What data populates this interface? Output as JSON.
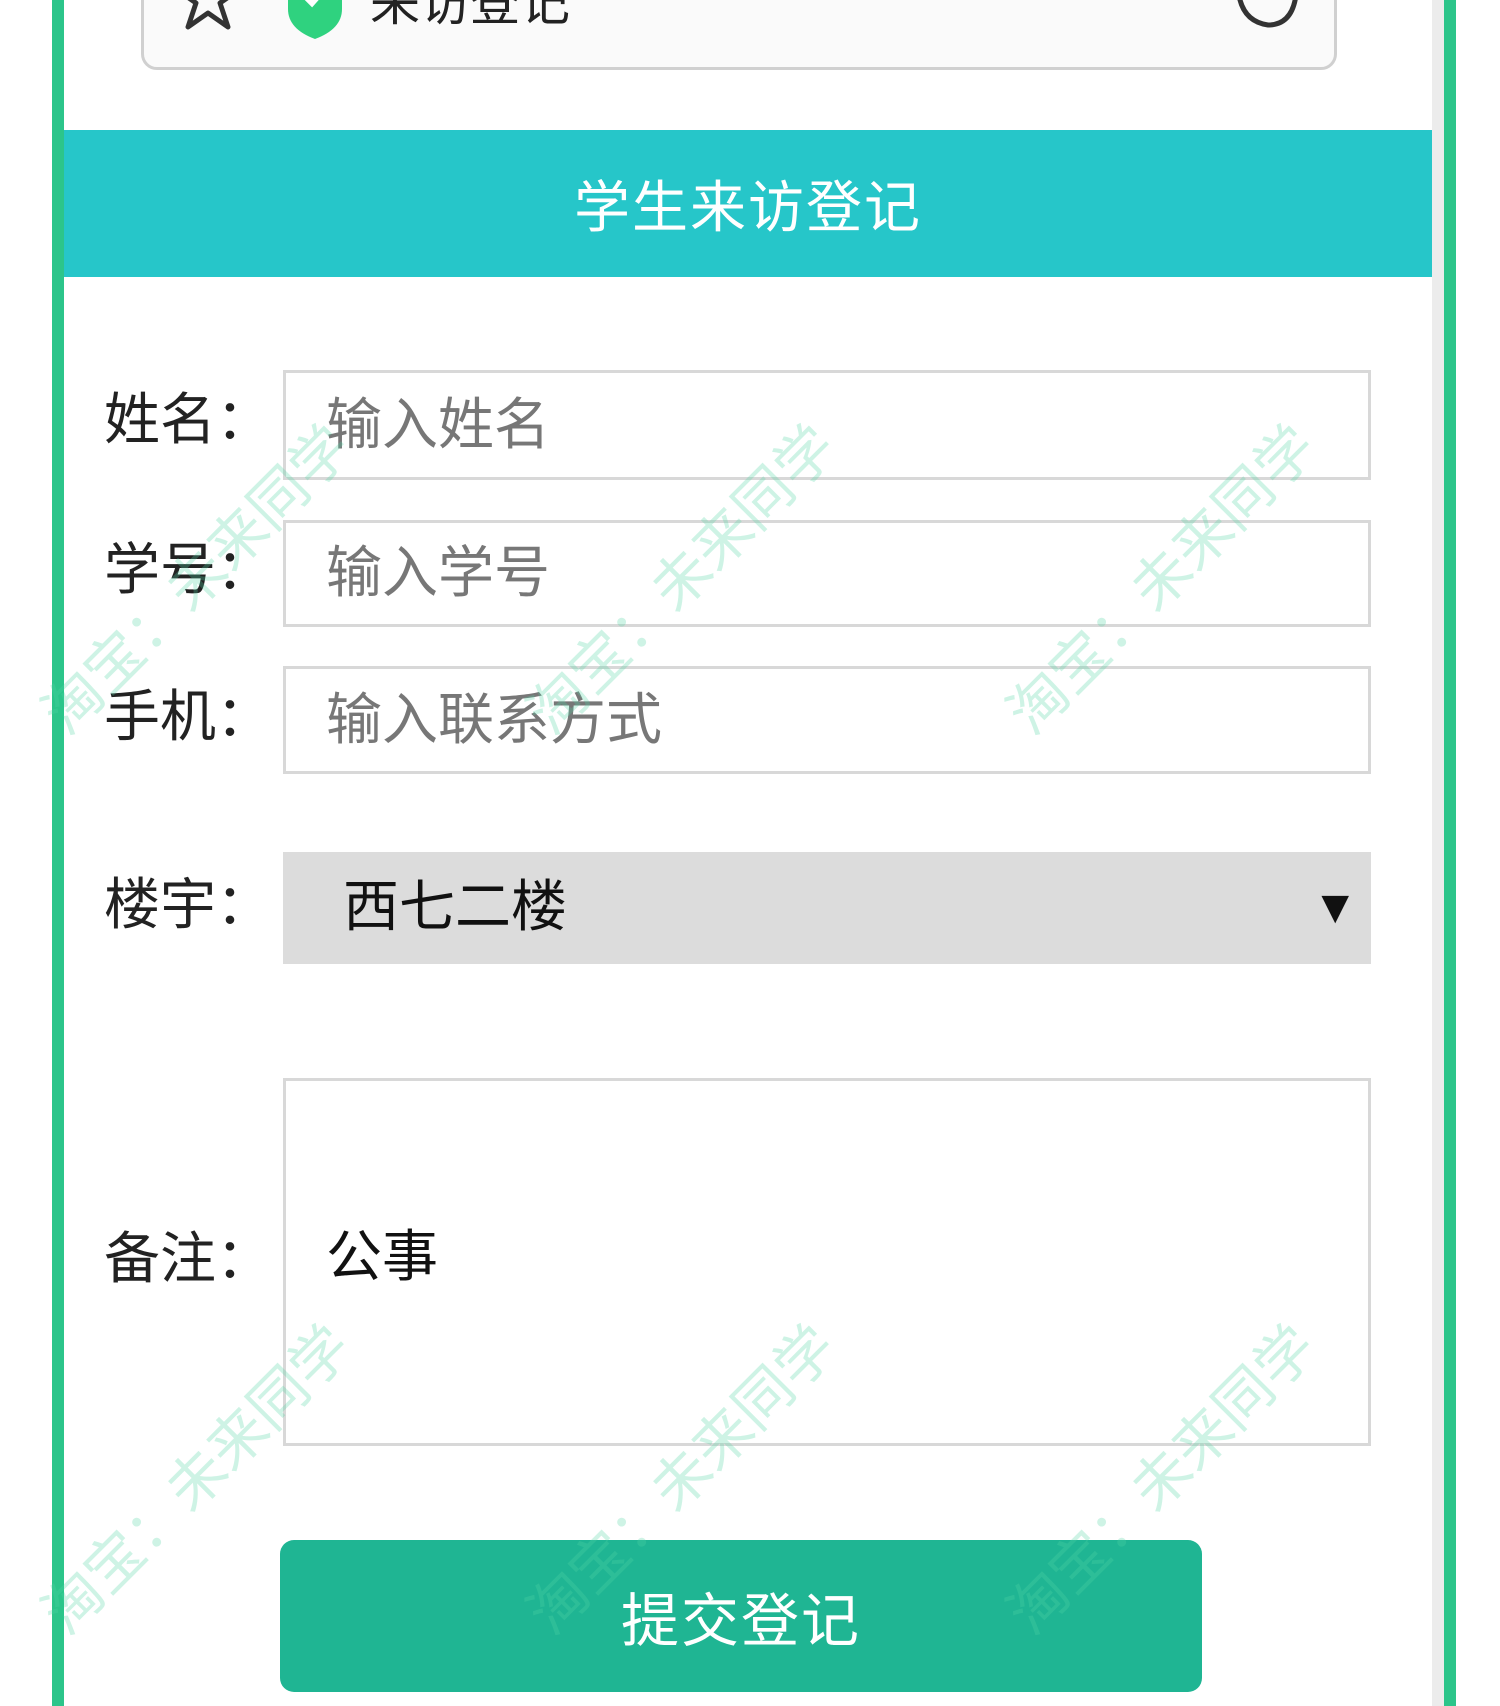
{
  "browser": {
    "page_title": "来访登记"
  },
  "header": {
    "title": "学生来访登记"
  },
  "form": {
    "name": {
      "label": "姓名：",
      "placeholder": "输入姓名",
      "value": ""
    },
    "student_id": {
      "label": "学号：",
      "placeholder": "输入学号",
      "value": ""
    },
    "phone": {
      "label": "手机：",
      "placeholder": "输入联系方式",
      "value": ""
    },
    "building": {
      "label": "楼宇：",
      "selected": "西七二楼",
      "arrow": "▼"
    },
    "remark": {
      "label": "备注：",
      "value": "公事"
    },
    "submit_label": "提交登记"
  },
  "watermark": {
    "text": "淘宝：未来同学"
  },
  "colors": {
    "header_bg": "#26c6c9",
    "submit_bg": "#1fb593",
    "frame": "#2cc58a",
    "select_bg": "#dcdcdc"
  }
}
